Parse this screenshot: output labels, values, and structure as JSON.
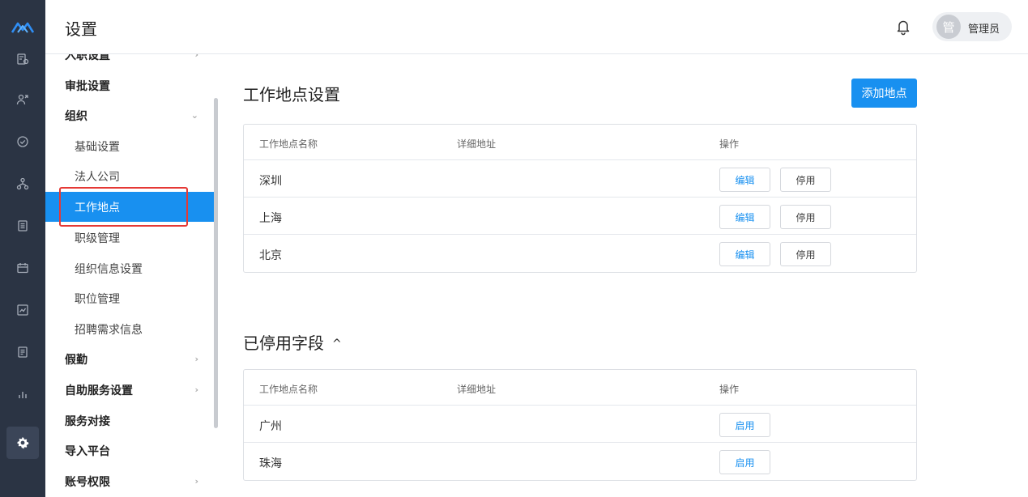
{
  "header": {
    "title": "设置",
    "user_avatar": "管",
    "user_name": "管理员"
  },
  "rail": {
    "logo_icon": "mountain-logo",
    "icons": [
      "id-card-icon",
      "user-arrow-icon",
      "check-circle-icon",
      "org-tree-icon",
      "document-icon",
      "calendar-icon",
      "chart-card-icon",
      "list-doc-icon",
      "bar-chart-icon",
      "gear-icon"
    ],
    "active": "gear-icon"
  },
  "sidebar": {
    "items": [
      {
        "label": "入职设置",
        "type": "group",
        "chevron": "›"
      },
      {
        "label": "审批设置",
        "type": "group"
      },
      {
        "label": "组织",
        "type": "group",
        "chevron": "⌄"
      },
      {
        "label": "基础设置",
        "type": "sub"
      },
      {
        "label": "法人公司",
        "type": "sub"
      },
      {
        "label": "工作地点",
        "type": "sub",
        "active": true
      },
      {
        "label": "职级管理",
        "type": "sub"
      },
      {
        "label": "组织信息设置",
        "type": "sub"
      },
      {
        "label": "职位管理",
        "type": "sub"
      },
      {
        "label": "招聘需求信息",
        "type": "sub"
      },
      {
        "label": "假勤",
        "type": "group",
        "chevron": "›"
      },
      {
        "label": "自助服务设置",
        "type": "group",
        "chevron": "›"
      },
      {
        "label": "服务对接",
        "type": "group"
      },
      {
        "label": "导入平台",
        "type": "group"
      },
      {
        "label": "账号权限",
        "type": "group",
        "chevron": "›"
      }
    ]
  },
  "main": {
    "title": "工作地点设置",
    "add_button": "添加地点",
    "columns": [
      "工作地点名称",
      "详细地址",
      "操作"
    ],
    "rows": [
      {
        "name": "深圳",
        "address": "",
        "edit": "编辑",
        "disable": "停用"
      },
      {
        "name": "上海",
        "address": "",
        "edit": "编辑",
        "disable": "停用"
      },
      {
        "name": "北京",
        "address": "",
        "edit": "编辑",
        "disable": "停用"
      }
    ]
  },
  "disabled": {
    "title": "已停用字段",
    "toggle": "^",
    "columns": [
      "工作地点名称",
      "详细地址",
      "操作"
    ],
    "rows": [
      {
        "name": "广州",
        "address": "",
        "enable": "启用"
      },
      {
        "name": "珠海",
        "address": "",
        "enable": "启用"
      }
    ]
  },
  "colors": {
    "primary": "#1890f0",
    "rail_bg": "#2b3444",
    "highlight_border": "#e53935"
  }
}
